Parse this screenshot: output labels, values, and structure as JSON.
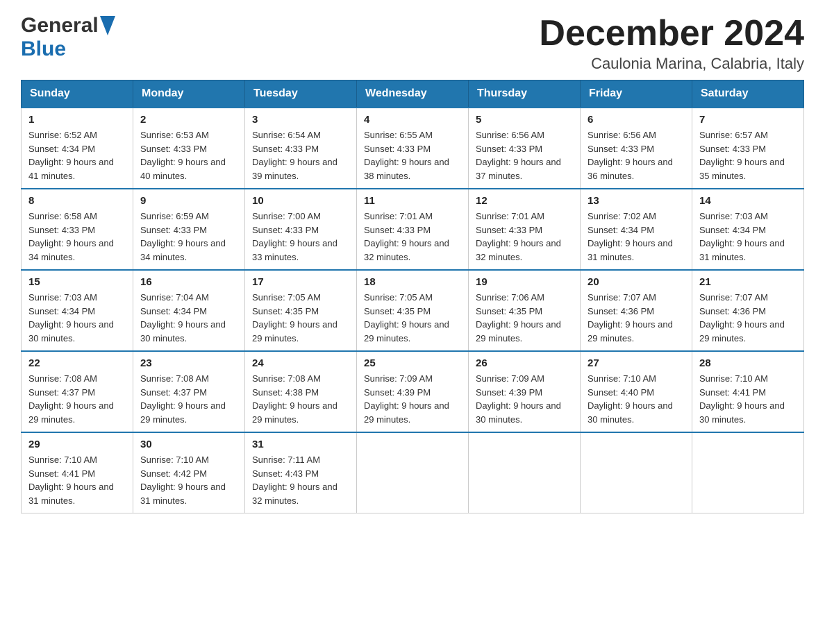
{
  "header": {
    "logo_text_general": "General",
    "logo_text_blue": "Blue",
    "month_title": "December 2024",
    "location": "Caulonia Marina, Calabria, Italy"
  },
  "days_of_week": [
    "Sunday",
    "Monday",
    "Tuesday",
    "Wednesday",
    "Thursday",
    "Friday",
    "Saturday"
  ],
  "weeks": [
    [
      {
        "day": "1",
        "sunrise": "6:52 AM",
        "sunset": "4:34 PM",
        "daylight": "9 hours and 41 minutes."
      },
      {
        "day": "2",
        "sunrise": "6:53 AM",
        "sunset": "4:33 PM",
        "daylight": "9 hours and 40 minutes."
      },
      {
        "day": "3",
        "sunrise": "6:54 AM",
        "sunset": "4:33 PM",
        "daylight": "9 hours and 39 minutes."
      },
      {
        "day": "4",
        "sunrise": "6:55 AM",
        "sunset": "4:33 PM",
        "daylight": "9 hours and 38 minutes."
      },
      {
        "day": "5",
        "sunrise": "6:56 AM",
        "sunset": "4:33 PM",
        "daylight": "9 hours and 37 minutes."
      },
      {
        "day": "6",
        "sunrise": "6:56 AM",
        "sunset": "4:33 PM",
        "daylight": "9 hours and 36 minutes."
      },
      {
        "day": "7",
        "sunrise": "6:57 AM",
        "sunset": "4:33 PM",
        "daylight": "9 hours and 35 minutes."
      }
    ],
    [
      {
        "day": "8",
        "sunrise": "6:58 AM",
        "sunset": "4:33 PM",
        "daylight": "9 hours and 34 minutes."
      },
      {
        "day": "9",
        "sunrise": "6:59 AM",
        "sunset": "4:33 PM",
        "daylight": "9 hours and 34 minutes."
      },
      {
        "day": "10",
        "sunrise": "7:00 AM",
        "sunset": "4:33 PM",
        "daylight": "9 hours and 33 minutes."
      },
      {
        "day": "11",
        "sunrise": "7:01 AM",
        "sunset": "4:33 PM",
        "daylight": "9 hours and 32 minutes."
      },
      {
        "day": "12",
        "sunrise": "7:01 AM",
        "sunset": "4:33 PM",
        "daylight": "9 hours and 32 minutes."
      },
      {
        "day": "13",
        "sunrise": "7:02 AM",
        "sunset": "4:34 PM",
        "daylight": "9 hours and 31 minutes."
      },
      {
        "day": "14",
        "sunrise": "7:03 AM",
        "sunset": "4:34 PM",
        "daylight": "9 hours and 31 minutes."
      }
    ],
    [
      {
        "day": "15",
        "sunrise": "7:03 AM",
        "sunset": "4:34 PM",
        "daylight": "9 hours and 30 minutes."
      },
      {
        "day": "16",
        "sunrise": "7:04 AM",
        "sunset": "4:34 PM",
        "daylight": "9 hours and 30 minutes."
      },
      {
        "day": "17",
        "sunrise": "7:05 AM",
        "sunset": "4:35 PM",
        "daylight": "9 hours and 29 minutes."
      },
      {
        "day": "18",
        "sunrise": "7:05 AM",
        "sunset": "4:35 PM",
        "daylight": "9 hours and 29 minutes."
      },
      {
        "day": "19",
        "sunrise": "7:06 AM",
        "sunset": "4:35 PM",
        "daylight": "9 hours and 29 minutes."
      },
      {
        "day": "20",
        "sunrise": "7:07 AM",
        "sunset": "4:36 PM",
        "daylight": "9 hours and 29 minutes."
      },
      {
        "day": "21",
        "sunrise": "7:07 AM",
        "sunset": "4:36 PM",
        "daylight": "9 hours and 29 minutes."
      }
    ],
    [
      {
        "day": "22",
        "sunrise": "7:08 AM",
        "sunset": "4:37 PM",
        "daylight": "9 hours and 29 minutes."
      },
      {
        "day": "23",
        "sunrise": "7:08 AM",
        "sunset": "4:37 PM",
        "daylight": "9 hours and 29 minutes."
      },
      {
        "day": "24",
        "sunrise": "7:08 AM",
        "sunset": "4:38 PM",
        "daylight": "9 hours and 29 minutes."
      },
      {
        "day": "25",
        "sunrise": "7:09 AM",
        "sunset": "4:39 PM",
        "daylight": "9 hours and 29 minutes."
      },
      {
        "day": "26",
        "sunrise": "7:09 AM",
        "sunset": "4:39 PM",
        "daylight": "9 hours and 30 minutes."
      },
      {
        "day": "27",
        "sunrise": "7:10 AM",
        "sunset": "4:40 PM",
        "daylight": "9 hours and 30 minutes."
      },
      {
        "day": "28",
        "sunrise": "7:10 AM",
        "sunset": "4:41 PM",
        "daylight": "9 hours and 30 minutes."
      }
    ],
    [
      {
        "day": "29",
        "sunrise": "7:10 AM",
        "sunset": "4:41 PM",
        "daylight": "9 hours and 31 minutes."
      },
      {
        "day": "30",
        "sunrise": "7:10 AM",
        "sunset": "4:42 PM",
        "daylight": "9 hours and 31 minutes."
      },
      {
        "day": "31",
        "sunrise": "7:11 AM",
        "sunset": "4:43 PM",
        "daylight": "9 hours and 32 minutes."
      },
      null,
      null,
      null,
      null
    ]
  ]
}
